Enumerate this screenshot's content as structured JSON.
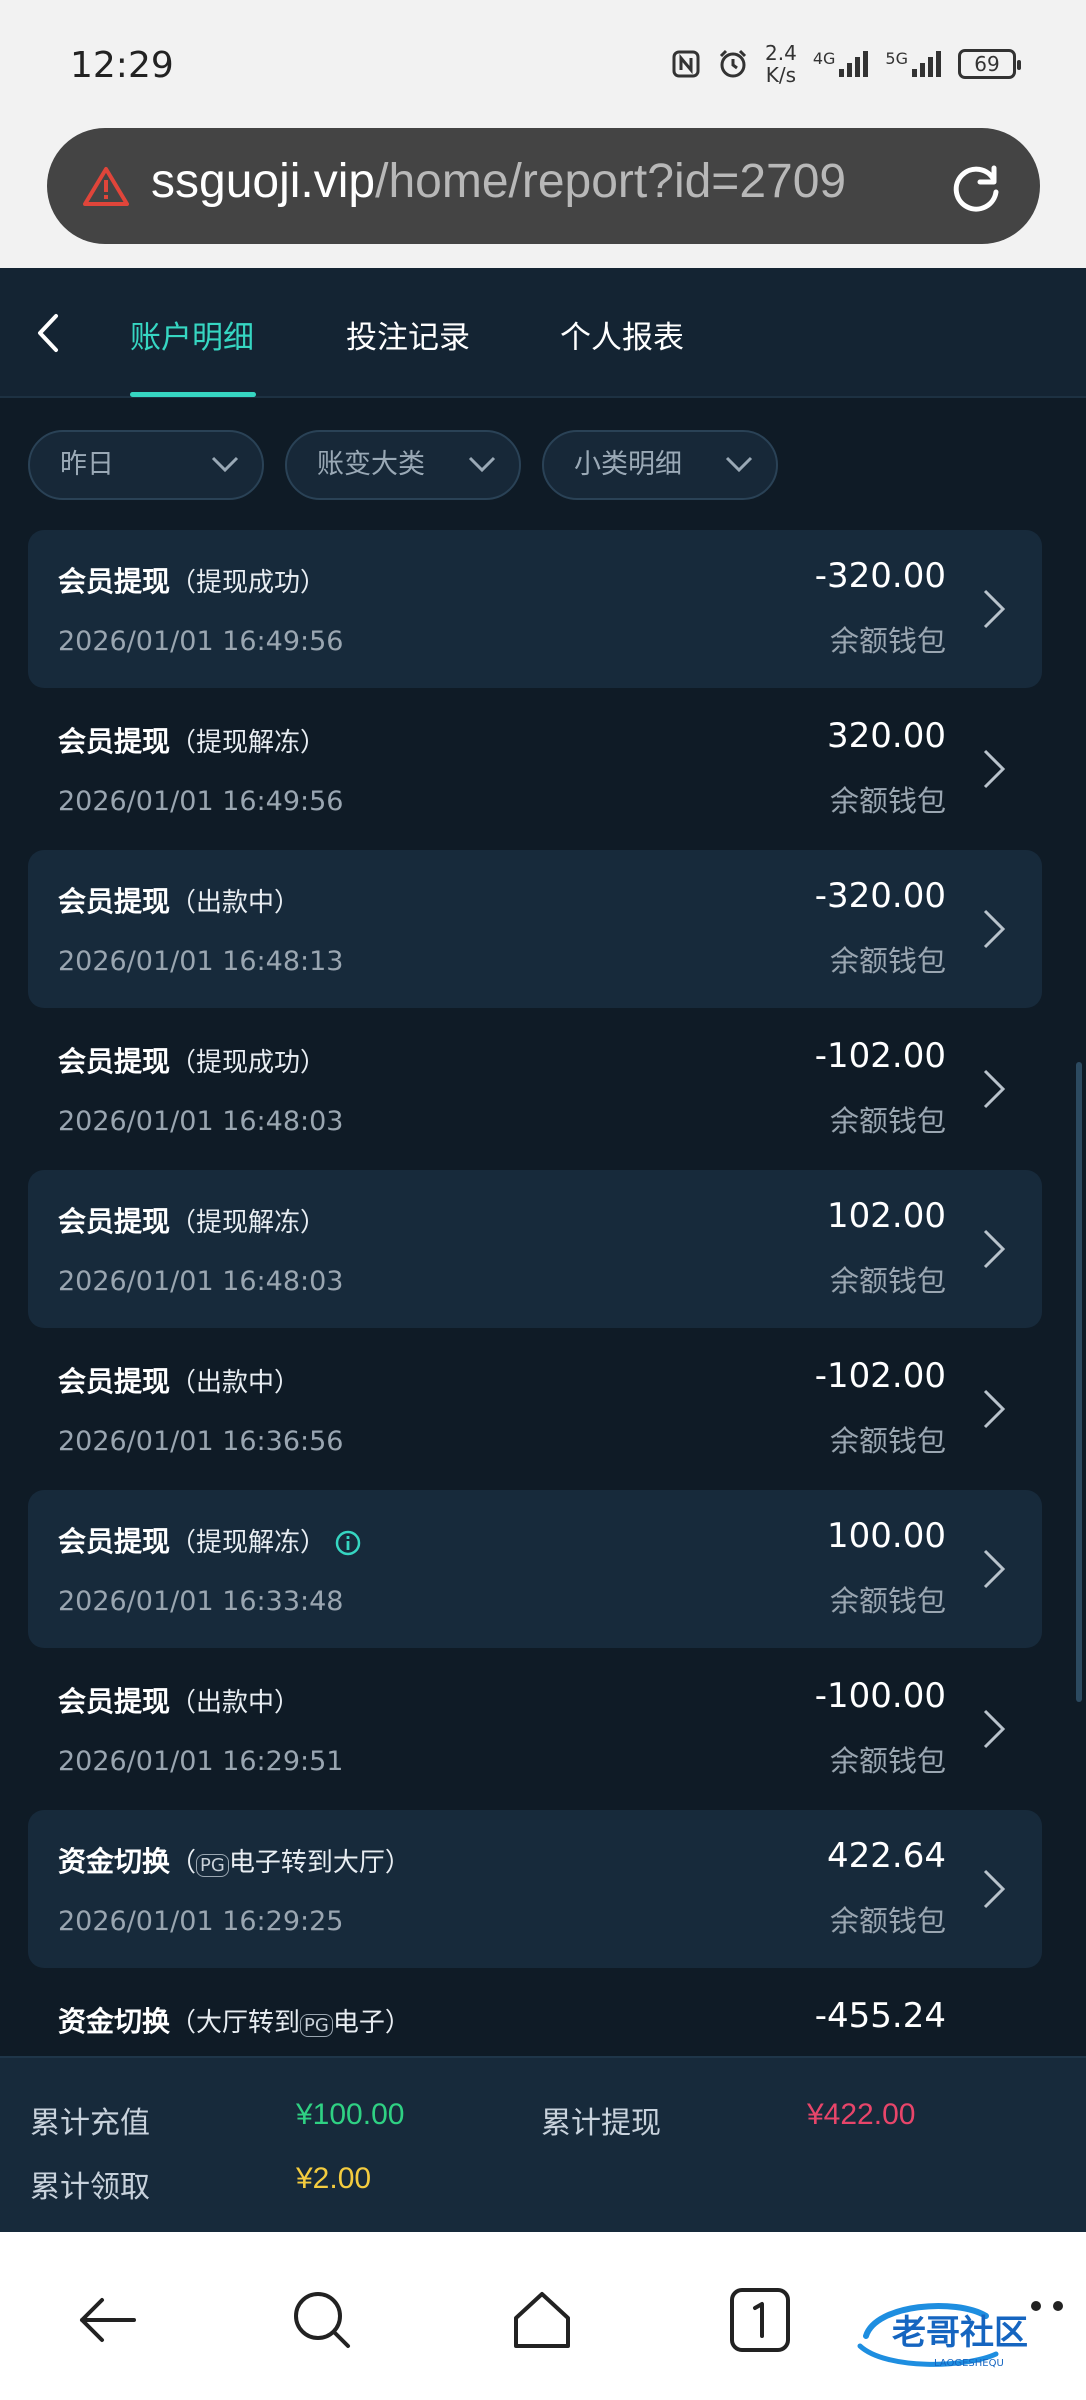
{
  "status": {
    "time": "12:29",
    "speed_value": "2.4",
    "speed_unit": "K/s",
    "net1": "4G",
    "net2": "5G",
    "battery": "69"
  },
  "browser": {
    "url_host": "ssguoji.vip",
    "url_path": "/home/report?id=2709"
  },
  "tabs": [
    {
      "label": "账户明细",
      "active": true
    },
    {
      "label": "投注记录"
    },
    {
      "label": "个人报表"
    }
  ],
  "filters": [
    {
      "label": "昨日"
    },
    {
      "label": "账变大类"
    },
    {
      "label": "小类明细"
    }
  ],
  "rows": [
    {
      "title": "会员提现",
      "sub": "（提现成功）",
      "date": "2026/01/01 16:49:56",
      "amount": "-320.00",
      "wallet": "余额钱包"
    },
    {
      "title": "会员提现",
      "sub": "（提现解冻）",
      "date": "2026/01/01 16:49:56",
      "amount": "320.00",
      "wallet": "余额钱包"
    },
    {
      "title": "会员提现",
      "sub": "（出款中）",
      "date": "2026/01/01 16:48:13",
      "amount": "-320.00",
      "wallet": "余额钱包"
    },
    {
      "title": "会员提现",
      "sub": "（提现成功）",
      "date": "2026/01/01 16:48:03",
      "amount": "-102.00",
      "wallet": "余额钱包"
    },
    {
      "title": "会员提现",
      "sub": "（提现解冻）",
      "date": "2026/01/01 16:48:03",
      "amount": "102.00",
      "wallet": "余额钱包"
    },
    {
      "title": "会员提现",
      "sub": "（出款中）",
      "date": "2026/01/01 16:36:56",
      "amount": "-102.00",
      "wallet": "余额钱包"
    },
    {
      "title": "会员提现",
      "sub": "（提现解冻）",
      "date": "2026/01/01 16:33:48",
      "amount": "100.00",
      "wallet": "余额钱包"
    },
    {
      "title": "会员提现",
      "sub": "（出款中）",
      "date": "2026/01/01 16:29:51",
      "amount": "-100.00",
      "wallet": "余额钱包"
    },
    {
      "title": "资金切换",
      "sub_pre": "（",
      "sub_brand": "PG",
      "sub": "电子转到大厅）",
      "date": "2026/01/01 16:29:25",
      "amount": "422.64",
      "wallet": "余额钱包"
    },
    {
      "title": "资金切换",
      "sub_pre": "（大厅转到",
      "sub_brand": "PG",
      "sub": "电子）",
      "date": "",
      "amount": "-455.24",
      "wallet": ""
    }
  ],
  "summary": {
    "recharge_label": "累计充值",
    "recharge_value": "¥100.00",
    "withdraw_label": "累计提现",
    "withdraw_value": "¥422.00",
    "claim_label": "累计领取",
    "claim_value": "¥2.00"
  },
  "colors": {
    "accent": "#36d6c2",
    "recharge": "#2fd183",
    "withdraw": "#e8456a",
    "claim": "#f4cc3f"
  },
  "watermark": {
    "text": "老哥社区",
    "sub": "LAOGESHEQU"
  }
}
